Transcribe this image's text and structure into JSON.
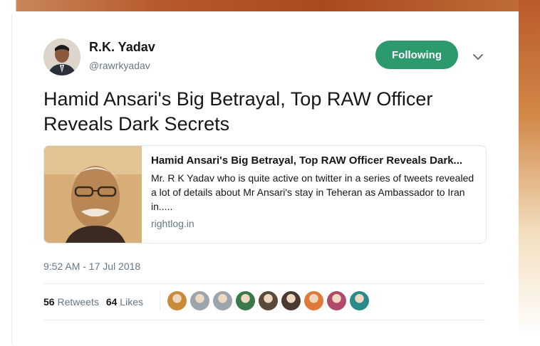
{
  "tweet": {
    "author": {
      "name": "R.K. Yadav",
      "handle": "@rawrkyadav"
    },
    "follow_label": "Following",
    "text": "Hamid Ansari's Big Betrayal, Top RAW Officer Reveals Dark Secrets",
    "link_card": {
      "title": "Hamid Ansari's Big Betrayal, Top RAW Officer Reveals Dark...",
      "description": "Mr. R K Yadav who is quite active on twitter in a series of tweets revealed a lot of details about Mr Ansari's stay in Teheran as Ambassador to Iran in.....",
      "domain": "rightlog.in"
    },
    "timestamp": "9:52 AM - 17 Jul 2018",
    "stats": {
      "retweets_count": "56",
      "retweets_label": "Retweets",
      "likes_count": "64",
      "likes_label": "Likes"
    }
  },
  "colors": {
    "follow_button": "#2d9a6e",
    "liker_avatars": [
      "#c98a3a",
      "#9aa5ae",
      "#9aa5ae",
      "#3a7a4a",
      "#5a4a3a",
      "#4a3a30",
      "#e07a3a",
      "#b04a6a",
      "#2a8a8a"
    ]
  }
}
